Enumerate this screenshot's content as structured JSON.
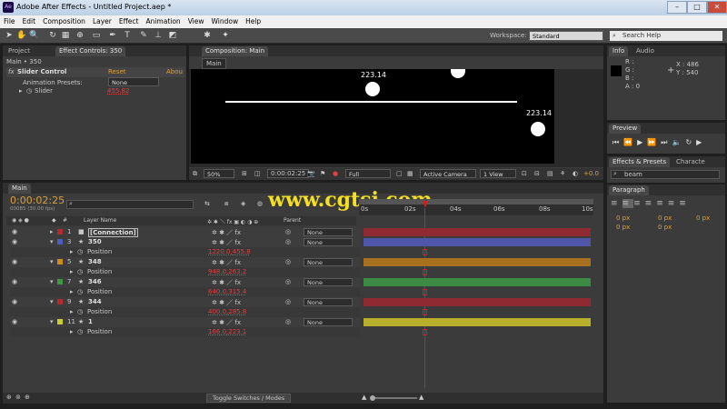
{
  "window": {
    "title": "Adobe After Effects - Untitled Project.aep *",
    "app_icon": "Ae"
  },
  "menu": [
    "File",
    "Edit",
    "Composition",
    "Layer",
    "Effect",
    "Animation",
    "View",
    "Window",
    "Help"
  ],
  "toolbar": {
    "workspace_label": "Workspace:",
    "workspace_value": "Standard",
    "search_placeholder": "Search Help"
  },
  "left_panel": {
    "tabs": [
      "Project",
      "Effect Controls: 350"
    ],
    "header": "Main • 350",
    "effect_name": "Slider Control",
    "reset": "Reset",
    "about": "Abou",
    "anim_presets_label": "Animation Presets:",
    "anim_presets_value": "None",
    "slider_label": "Slider",
    "slider_value": "455.82"
  },
  "comp_panel": {
    "tab": "Composition: Main",
    "comp_tab": "Main",
    "label1": "223.14",
    "label2": "223.14",
    "zoom": "50%",
    "timecode": "0:00:02:25",
    "resolution": "Full",
    "camera": "Active Camera",
    "views": "1 View",
    "exposure": "+0.0"
  },
  "info_panel": {
    "tabs": [
      "Info",
      "Audio"
    ],
    "r": "R :",
    "g": "G :",
    "b": "B :",
    "a": "A : 0",
    "x": "X : 486",
    "y": "Y : 540"
  },
  "preview_panel": {
    "tab": "Preview"
  },
  "effects_panel": {
    "tabs": [
      "Effects & Presets",
      "Characte"
    ],
    "search": "beam"
  },
  "paragraph_panel": {
    "tab": "Paragraph",
    "px_values": [
      "0 px",
      "0 px",
      "0 px",
      "0 px",
      "0 px"
    ]
  },
  "timeline": {
    "tab": "Main",
    "timecode": "0:00:02:25",
    "frame_info": "00085 (30.00 fps)",
    "col_num": "#",
    "col_layer_name": "Layer Name",
    "col_parent": "Parent",
    "ruler": [
      "0s",
      "02s",
      "04s",
      "06s",
      "08s",
      "10s"
    ],
    "toggle_label": "Toggle Switches / Modes",
    "watermark": "www.cgtsj.com",
    "layers": [
      {
        "num": "1",
        "name": "[Connection]",
        "color": "#b52a2a",
        "bar": "#8f2a33",
        "parent": "None",
        "expanded": false,
        "position": ""
      },
      {
        "num": "3",
        "name": "350",
        "color": "#4a5fbd",
        "bar": "#4f55a8",
        "parent": "None",
        "expanded": true,
        "position": "1220.0,455.8"
      },
      {
        "num": "5",
        "name": "348",
        "color": "#d08a1d",
        "bar": "#a6701e",
        "parent": "None",
        "expanded": true,
        "position": "948.0,263.2"
      },
      {
        "num": "7",
        "name": "346",
        "color": "#3e9a3e",
        "bar": "#3d8a44",
        "parent": "None",
        "expanded": true,
        "position": "640.0,315.4"
      },
      {
        "num": "9",
        "name": "344",
        "color": "#b52a2a",
        "bar": "#8f2a33",
        "parent": "None",
        "expanded": true,
        "position": "400.0,285.8"
      },
      {
        "num": "11",
        "name": "1",
        "color": "#cccc2a",
        "bar": "#b8b02a",
        "parent": "None",
        "expanded": true,
        "position": "166.0,223.1"
      }
    ],
    "position_label": "Position"
  },
  "colors": {
    "accent_orange": "#e6a23c",
    "playhead_red": "#d02020",
    "watermark": "#f5e020"
  }
}
